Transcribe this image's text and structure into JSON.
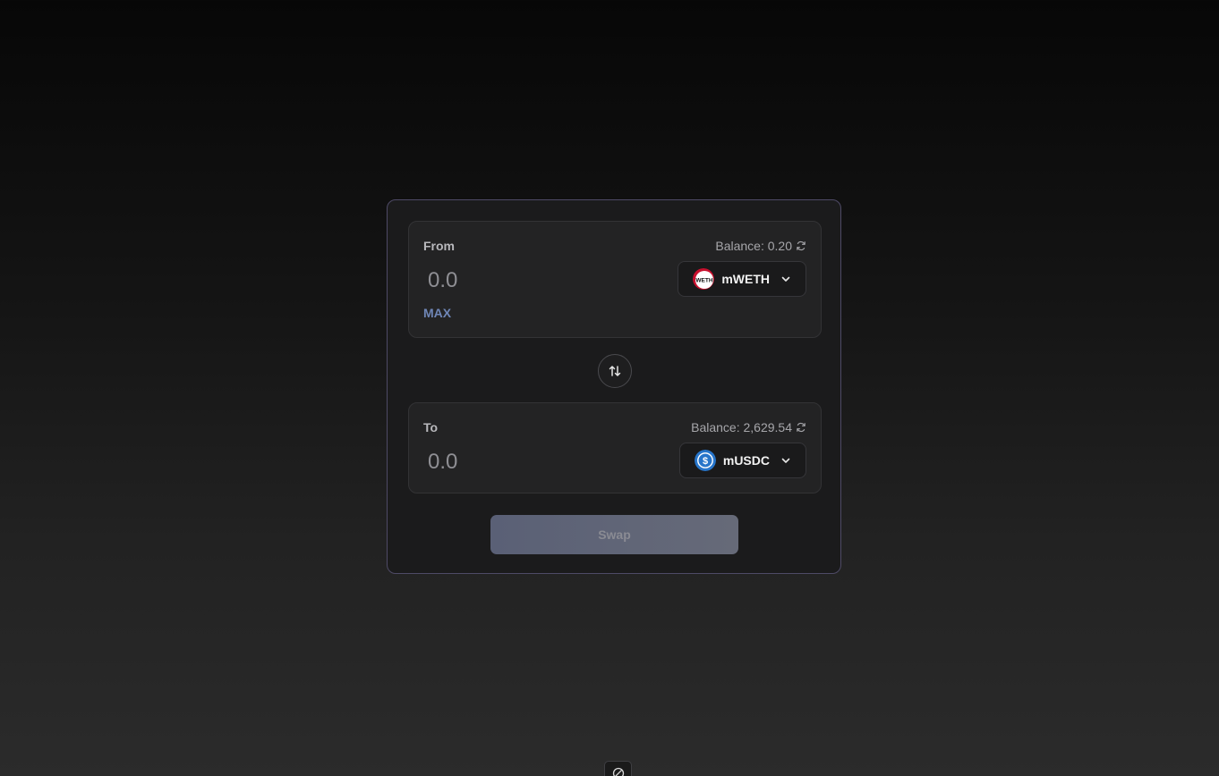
{
  "from_panel": {
    "label": "From",
    "balance": "Balance: 0.20",
    "amount_placeholder": "0.0",
    "max_label": "MAX",
    "token": {
      "symbol": "mWETH",
      "logo_text": "WETH",
      "logo_color": "#c8102e"
    }
  },
  "to_panel": {
    "label": "To",
    "balance": "Balance: 2,629.54",
    "amount_placeholder": "0.0",
    "token": {
      "symbol": "mUSDC",
      "logo_text": "$",
      "logo_color": "#2775ca"
    }
  },
  "swap_button": {
    "label": "Swap",
    "disabled": true
  },
  "icons": {
    "refresh": "refresh-icon",
    "chevron": "chevron-down-icon",
    "swap_direction": "swap-arrows-icon",
    "corner": "no-entry-icon"
  },
  "colors": {
    "card_border": "#4e4a66",
    "accent_max": "#6f86b6",
    "swap_button_bg": "#5f6476"
  }
}
